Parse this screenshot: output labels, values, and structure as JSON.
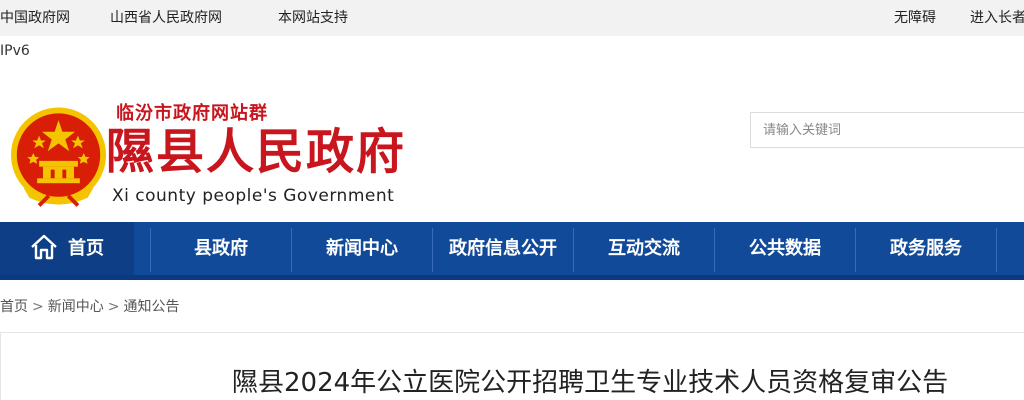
{
  "topbar": {
    "left_links": [
      "中国政府网",
      "山西省人民政府网",
      "本网站支持"
    ],
    "right_links": [
      "无障碍",
      "进入长者"
    ]
  },
  "ipv6": "IPv6",
  "header": {
    "site_group": "临汾市政府网站群",
    "title": "隰县人民政府",
    "title_en": "Xi county people's Government"
  },
  "search": {
    "placeholder": "请输入关键词"
  },
  "nav": {
    "items": [
      "首页",
      "县政府",
      "新闻中心",
      "政府信息公开",
      "互动交流",
      "公共数据",
      "政务服务"
    ]
  },
  "breadcrumb": [
    "首页",
    "新闻中心",
    "通知公告"
  ],
  "article": {
    "title": "隰县2024年公立医院公开招聘卫生专业技术人员资格复审公告"
  },
  "colors": {
    "brand_red": "#c8161e",
    "nav_blue": "#124a9a"
  }
}
